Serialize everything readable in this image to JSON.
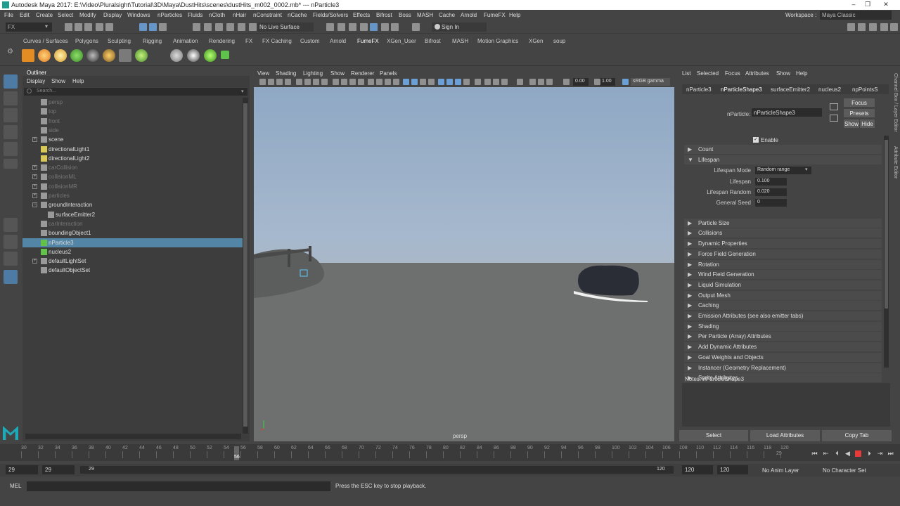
{
  "window": {
    "title": "Autodesk Maya 2017: E:\\Video\\Pluralsight\\Tutorial\\3D\\Maya\\DustHits\\scenes\\dustHits_m002_0002.mb*  ---  nParticle3"
  },
  "menubar": {
    "items": [
      "File",
      "Edit",
      "Create",
      "Select",
      "Modify",
      "Display",
      "Windows",
      "nParticles",
      "Fluids",
      "nCloth",
      "nHair",
      "nConstraint",
      "nCache",
      "Fields/Solvers",
      "Effects",
      "Bifrost",
      "Boss",
      "MASH",
      "Cache",
      "Arnold",
      "FumeFX",
      "Help"
    ],
    "workspace_label": "Workspace :",
    "workspace_value": "Maya Classic"
  },
  "statusline": {
    "mode": "FX",
    "live_surface": "No Live Surface",
    "sign_in": "Sign In"
  },
  "shelf": {
    "tabs": [
      "Curves / Surfaces",
      "Polygons",
      "Sculpting",
      "Rigging",
      "Animation",
      "Rendering",
      "FX",
      "FX Caching",
      "Custom",
      "Arnold",
      "FumeFX",
      "XGen_User",
      "Bifrost",
      "MASH",
      "Motion Graphics",
      "XGen",
      "soup"
    ],
    "active_tab": "FumeFX"
  },
  "outliner": {
    "title": "Outliner",
    "menus": [
      "Display",
      "Show",
      "Help"
    ],
    "search_placeholder": "Search...",
    "items": [
      {
        "label": "persp",
        "dim": true,
        "indent": 1
      },
      {
        "label": "top",
        "dim": true,
        "indent": 1
      },
      {
        "label": "front",
        "dim": true,
        "indent": 1
      },
      {
        "label": "side",
        "dim": true,
        "indent": 1
      },
      {
        "label": "scene",
        "dim": false,
        "indent": 1,
        "expand": "+"
      },
      {
        "label": "directionalLight1",
        "dim": false,
        "indent": 1
      },
      {
        "label": "directionalLight2",
        "dim": false,
        "indent": 1
      },
      {
        "label": "carCollision",
        "dim": true,
        "indent": 1,
        "expand": "+"
      },
      {
        "label": "collisionML",
        "dim": true,
        "indent": 1,
        "expand": "+"
      },
      {
        "label": "collisionMR",
        "dim": true,
        "indent": 1,
        "expand": "+"
      },
      {
        "label": "particles",
        "dim": true,
        "indent": 1,
        "expand": "+"
      },
      {
        "label": "groundInteraction",
        "dim": false,
        "indent": 1,
        "expand": "−"
      },
      {
        "label": "surfaceEmitter2",
        "dim": false,
        "indent": 2
      },
      {
        "label": "carInteraction",
        "dim": true,
        "indent": 1
      },
      {
        "label": "boundingObject1",
        "dim": false,
        "indent": 1
      },
      {
        "label": "nParticle3",
        "dim": false,
        "indent": 1,
        "selected": true
      },
      {
        "label": "nucleus2",
        "dim": false,
        "indent": 1
      },
      {
        "label": "defaultLightSet",
        "dim": false,
        "indent": 1,
        "expand": "+"
      },
      {
        "label": "defaultObjectSet",
        "dim": false,
        "indent": 1
      }
    ]
  },
  "viewport": {
    "menus": [
      "View",
      "Shading",
      "Lighting",
      "Show",
      "Renderer",
      "Panels"
    ],
    "field_exposure": "0.00",
    "field_gamma": "1.00",
    "color_space": "sRGB gamma",
    "camera_label": "persp"
  },
  "attribute_editor": {
    "menus": [
      "List",
      "Selected",
      "Focus",
      "Attributes",
      "Show",
      "Help"
    ],
    "tabs": [
      "nParticle3",
      "nParticleShape3",
      "surfaceEmitter2",
      "nucleus2",
      "npPointsS"
    ],
    "active_tab": "nParticleShape3",
    "node_label": "nParticle:",
    "node_value": "nParticleShape3",
    "buttons": {
      "focus": "Focus",
      "presets": "Presets",
      "show": "Show",
      "hide": "Hide"
    },
    "enable_label": "Enable",
    "sections": [
      {
        "label": "Count",
        "open": false
      },
      {
        "label": "Lifespan",
        "open": true
      },
      {
        "label": "Particle Size",
        "open": false
      },
      {
        "label": "Collisions",
        "open": false
      },
      {
        "label": "Dynamic Properties",
        "open": false
      },
      {
        "label": "Force Field Generation",
        "open": false
      },
      {
        "label": "Rotation",
        "open": false
      },
      {
        "label": "Wind Field Generation",
        "open": false
      },
      {
        "label": "Liquid Simulation",
        "open": false
      },
      {
        "label": "Output Mesh",
        "open": false
      },
      {
        "label": "Caching",
        "open": false
      },
      {
        "label": "Emission Attributes (see also emitter tabs)",
        "open": false
      },
      {
        "label": "Shading",
        "open": false
      },
      {
        "label": "Per Particle (Array) Attributes",
        "open": false
      },
      {
        "label": "Add Dynamic Attributes",
        "open": false
      },
      {
        "label": "Goal Weights and Objects",
        "open": false
      },
      {
        "label": "Instancer (Geometry Replacement)",
        "open": false
      },
      {
        "label": "Sprite Attributes",
        "open": false
      }
    ],
    "lifespan": {
      "mode_label": "Lifespan Mode",
      "mode_value": "Random range",
      "lifespan_label": "Lifespan",
      "lifespan_value": "0.100",
      "random_label": "Lifespan Random",
      "random_value": "0.020",
      "seed_label": "General Seed",
      "seed_value": "0"
    },
    "notes": "Notes:  nParticleShape3",
    "bottom_buttons": [
      "Select",
      "Load Attributes",
      "Copy Tab"
    ]
  },
  "right_strip": {
    "labels": [
      "Channel Box / Layer Editor",
      "Attribute Editor"
    ]
  },
  "timeline": {
    "ticks": [
      "30",
      "32",
      "34",
      "36",
      "38",
      "40",
      "42",
      "44",
      "46",
      "48",
      "50",
      "52",
      "54",
      "56",
      "58",
      "60",
      "62",
      "64",
      "66",
      "68",
      "70",
      "72",
      "74",
      "76",
      "78",
      "80",
      "82",
      "84",
      "86",
      "88",
      "90",
      "92",
      "94",
      "96",
      "98",
      "100",
      "102",
      "104",
      "106",
      "108",
      "110",
      "112",
      "114",
      "116",
      "118",
      "120"
    ],
    "current_frame": "56",
    "current_field": "29"
  },
  "range": {
    "start": "29",
    "playback_start": "29",
    "slider_start": "29",
    "slider_end": "120",
    "playback_end": "120",
    "end": "120",
    "anim_layer": "No Anim Layer",
    "character_set": "No Character Set"
  },
  "commandline": {
    "lang": "MEL",
    "help": "Press the ESC key to stop playback."
  }
}
